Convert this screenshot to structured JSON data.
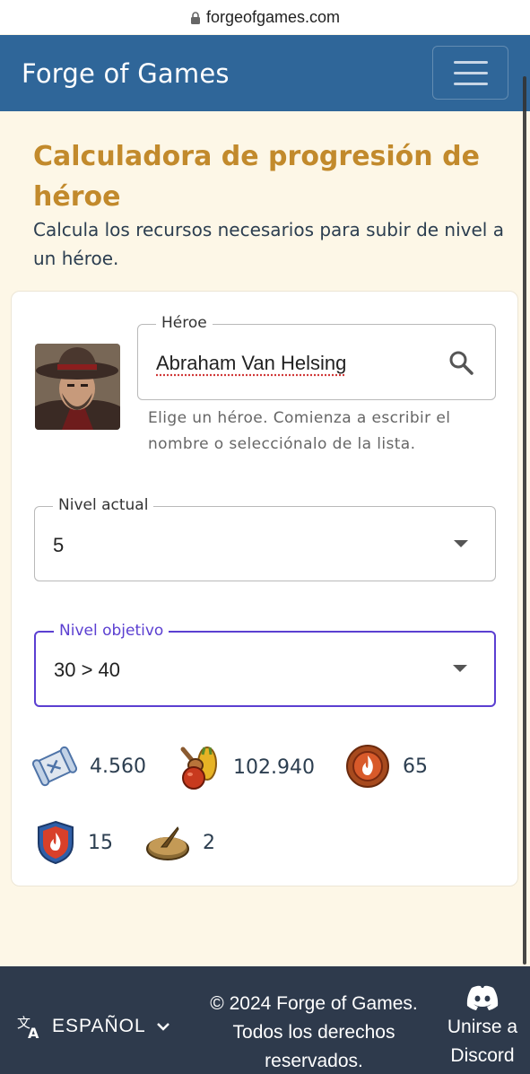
{
  "browser": {
    "url": "forgeofgames.com"
  },
  "navbar": {
    "brand": "Forge of Games"
  },
  "page": {
    "title": "Calculadora de progresión de héroe",
    "subtitle": "Calcula los recursos necesarios para subir de nivel a un héroe."
  },
  "hero_field": {
    "legend": "Héroe",
    "value": "Abraham Van Helsing",
    "helper": "Elige un héroe. Comienza a escribir el nombre o selecciónalo de la lista."
  },
  "current_level": {
    "legend": "Nivel actual",
    "value": "5"
  },
  "target_level": {
    "legend": "Nivel objetivo",
    "value": "30 > 40"
  },
  "resources": [
    {
      "icon": "scroll-icon",
      "value": "4.560"
    },
    {
      "icon": "food-icon",
      "value": "102.940"
    },
    {
      "icon": "fire-medallion-icon",
      "value": "65"
    },
    {
      "icon": "fire-shield-icon",
      "value": "15"
    },
    {
      "icon": "sundial-icon",
      "value": "2"
    }
  ],
  "footer": {
    "language": "ESPAÑOL",
    "copyright": "© 2024 Forge of Games. Todos los derechos reservados.",
    "discord": "Unirse a Discord"
  },
  "colors": {
    "navbar": "#2f6699",
    "title": "#c28a2c",
    "background": "#fdf7e7",
    "focus": "#5b3fd1",
    "footer": "#2e3a4c"
  }
}
